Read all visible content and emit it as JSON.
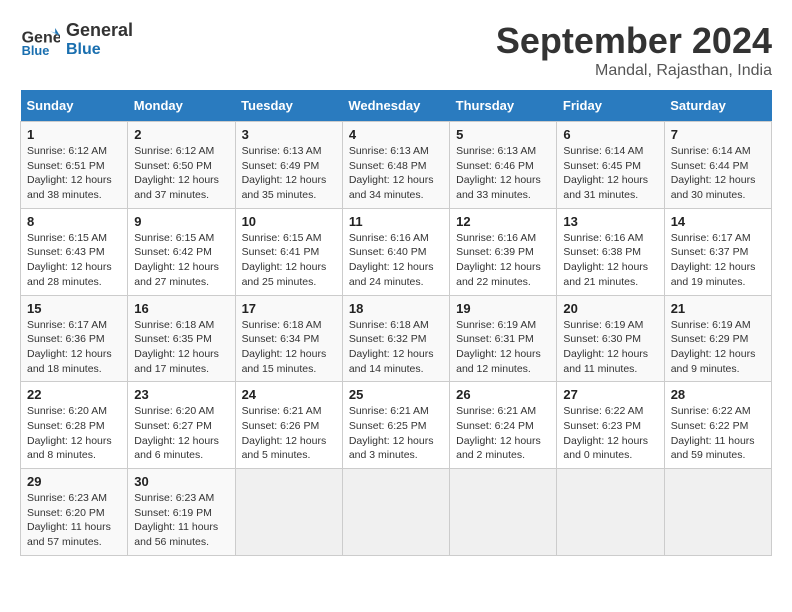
{
  "header": {
    "logo_line1": "General",
    "logo_line2": "Blue",
    "month": "September 2024",
    "location": "Mandal, Rajasthan, India"
  },
  "days_of_week": [
    "Sunday",
    "Monday",
    "Tuesday",
    "Wednesday",
    "Thursday",
    "Friday",
    "Saturday"
  ],
  "weeks": [
    [
      {
        "day": "1",
        "info": "Sunrise: 6:12 AM\nSunset: 6:51 PM\nDaylight: 12 hours\nand 38 minutes."
      },
      {
        "day": "2",
        "info": "Sunrise: 6:12 AM\nSunset: 6:50 PM\nDaylight: 12 hours\nand 37 minutes."
      },
      {
        "day": "3",
        "info": "Sunrise: 6:13 AM\nSunset: 6:49 PM\nDaylight: 12 hours\nand 35 minutes."
      },
      {
        "day": "4",
        "info": "Sunrise: 6:13 AM\nSunset: 6:48 PM\nDaylight: 12 hours\nand 34 minutes."
      },
      {
        "day": "5",
        "info": "Sunrise: 6:13 AM\nSunset: 6:46 PM\nDaylight: 12 hours\nand 33 minutes."
      },
      {
        "day": "6",
        "info": "Sunrise: 6:14 AM\nSunset: 6:45 PM\nDaylight: 12 hours\nand 31 minutes."
      },
      {
        "day": "7",
        "info": "Sunrise: 6:14 AM\nSunset: 6:44 PM\nDaylight: 12 hours\nand 30 minutes."
      }
    ],
    [
      {
        "day": "8",
        "info": "Sunrise: 6:15 AM\nSunset: 6:43 PM\nDaylight: 12 hours\nand 28 minutes."
      },
      {
        "day": "9",
        "info": "Sunrise: 6:15 AM\nSunset: 6:42 PM\nDaylight: 12 hours\nand 27 minutes."
      },
      {
        "day": "10",
        "info": "Sunrise: 6:15 AM\nSunset: 6:41 PM\nDaylight: 12 hours\nand 25 minutes."
      },
      {
        "day": "11",
        "info": "Sunrise: 6:16 AM\nSunset: 6:40 PM\nDaylight: 12 hours\nand 24 minutes."
      },
      {
        "day": "12",
        "info": "Sunrise: 6:16 AM\nSunset: 6:39 PM\nDaylight: 12 hours\nand 22 minutes."
      },
      {
        "day": "13",
        "info": "Sunrise: 6:16 AM\nSunset: 6:38 PM\nDaylight: 12 hours\nand 21 minutes."
      },
      {
        "day": "14",
        "info": "Sunrise: 6:17 AM\nSunset: 6:37 PM\nDaylight: 12 hours\nand 19 minutes."
      }
    ],
    [
      {
        "day": "15",
        "info": "Sunrise: 6:17 AM\nSunset: 6:36 PM\nDaylight: 12 hours\nand 18 minutes."
      },
      {
        "day": "16",
        "info": "Sunrise: 6:18 AM\nSunset: 6:35 PM\nDaylight: 12 hours\nand 17 minutes."
      },
      {
        "day": "17",
        "info": "Sunrise: 6:18 AM\nSunset: 6:34 PM\nDaylight: 12 hours\nand 15 minutes."
      },
      {
        "day": "18",
        "info": "Sunrise: 6:18 AM\nSunset: 6:32 PM\nDaylight: 12 hours\nand 14 minutes."
      },
      {
        "day": "19",
        "info": "Sunrise: 6:19 AM\nSunset: 6:31 PM\nDaylight: 12 hours\nand 12 minutes."
      },
      {
        "day": "20",
        "info": "Sunrise: 6:19 AM\nSunset: 6:30 PM\nDaylight: 12 hours\nand 11 minutes."
      },
      {
        "day": "21",
        "info": "Sunrise: 6:19 AM\nSunset: 6:29 PM\nDaylight: 12 hours\nand 9 minutes."
      }
    ],
    [
      {
        "day": "22",
        "info": "Sunrise: 6:20 AM\nSunset: 6:28 PM\nDaylight: 12 hours\nand 8 minutes."
      },
      {
        "day": "23",
        "info": "Sunrise: 6:20 AM\nSunset: 6:27 PM\nDaylight: 12 hours\nand 6 minutes."
      },
      {
        "day": "24",
        "info": "Sunrise: 6:21 AM\nSunset: 6:26 PM\nDaylight: 12 hours\nand 5 minutes."
      },
      {
        "day": "25",
        "info": "Sunrise: 6:21 AM\nSunset: 6:25 PM\nDaylight: 12 hours\nand 3 minutes."
      },
      {
        "day": "26",
        "info": "Sunrise: 6:21 AM\nSunset: 6:24 PM\nDaylight: 12 hours\nand 2 minutes."
      },
      {
        "day": "27",
        "info": "Sunrise: 6:22 AM\nSunset: 6:23 PM\nDaylight: 12 hours\nand 0 minutes."
      },
      {
        "day": "28",
        "info": "Sunrise: 6:22 AM\nSunset: 6:22 PM\nDaylight: 11 hours\nand 59 minutes."
      }
    ],
    [
      {
        "day": "29",
        "info": "Sunrise: 6:23 AM\nSunset: 6:20 PM\nDaylight: 11 hours\nand 57 minutes."
      },
      {
        "day": "30",
        "info": "Sunrise: 6:23 AM\nSunset: 6:19 PM\nDaylight: 11 hours\nand 56 minutes."
      },
      {
        "day": "",
        "info": ""
      },
      {
        "day": "",
        "info": ""
      },
      {
        "day": "",
        "info": ""
      },
      {
        "day": "",
        "info": ""
      },
      {
        "day": "",
        "info": ""
      }
    ]
  ]
}
